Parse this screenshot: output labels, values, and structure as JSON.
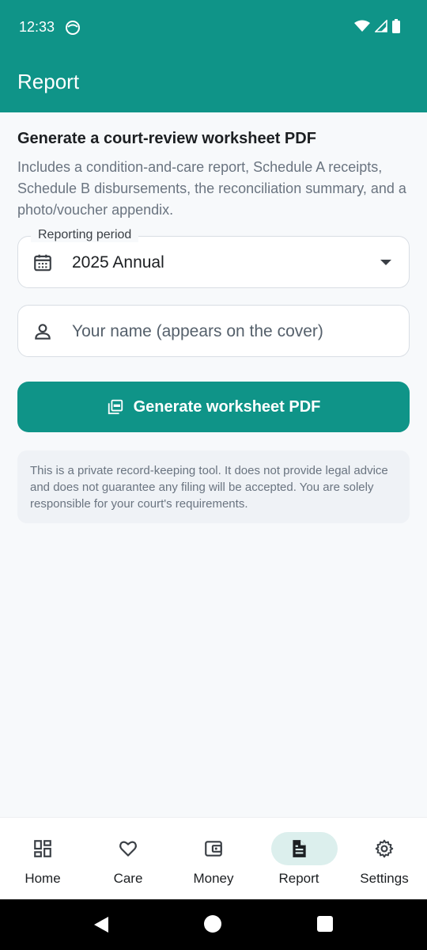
{
  "status_bar": {
    "time": "12:33"
  },
  "app_bar": {
    "title": "Report"
  },
  "content": {
    "heading": "Generate a court-review worksheet PDF",
    "description": "Includes a condition-and-care report, Schedule A receipts, Schedule B disbursements, the reconciliation summary, and a photo/voucher appendix.",
    "period_field": {
      "label": "Reporting period",
      "value": "2025 Annual"
    },
    "name_field": {
      "placeholder": "Your name (appears on the cover)",
      "value": ""
    },
    "generate_button": "Generate worksheet PDF",
    "disclaimer": "This is a private record-keeping tool. It does not provide legal advice and does not guarantee any filing will be accepted. You are solely responsible for your court's requirements."
  },
  "bottom_nav": {
    "items": [
      {
        "label": "Home",
        "icon": "dashboard-icon"
      },
      {
        "label": "Care",
        "icon": "heart-icon"
      },
      {
        "label": "Money",
        "icon": "wallet-icon"
      },
      {
        "label": "Report",
        "icon": "document-icon",
        "active": true
      },
      {
        "label": "Settings",
        "icon": "gear-icon"
      }
    ]
  },
  "colors": {
    "primary": "#0f9488",
    "active_pill": "#dcefed",
    "background": "#f7f9fb"
  }
}
